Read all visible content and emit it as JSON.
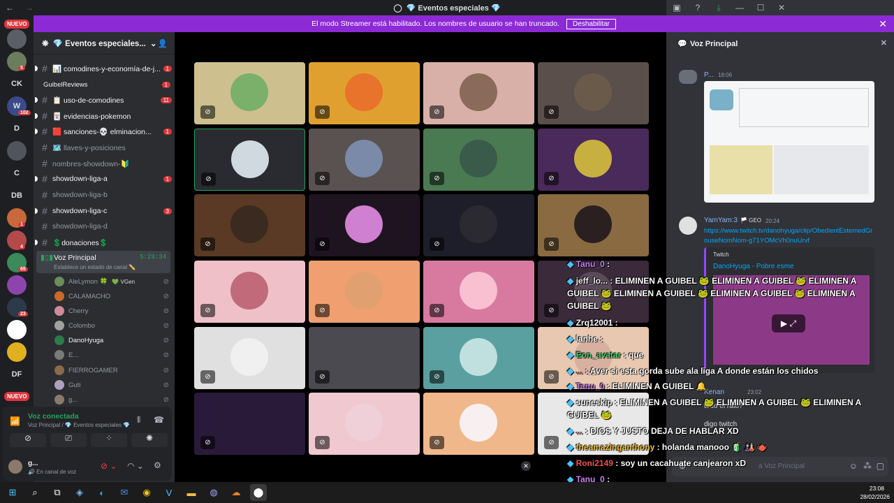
{
  "window": {
    "title": "💎 Eventos especiales 💎"
  },
  "banner": {
    "text": "El modo Streamer está habilitado. Los nombres de usuario se han truncado.",
    "button": "Deshabilitar"
  },
  "guilds": [
    {
      "label": "",
      "color": "#5a5f66"
    },
    {
      "label": "",
      "color": "#6b7d5c"
    },
    {
      "label": "CK",
      "color": "#1e1f22"
    },
    {
      "label": "W",
      "color": "#3b4a8a"
    },
    {
      "label": "D",
      "color": "#1e1f22"
    },
    {
      "label": "",
      "color": "#50545c"
    },
    {
      "label": "C",
      "color": "#1e1f22"
    },
    {
      "label": "DB",
      "color": "#1e1f22"
    },
    {
      "label": "",
      "color": "#c9683a"
    },
    {
      "label": "",
      "color": "#b34a4a"
    },
    {
      "label": "",
      "color": "#3a8a5a"
    },
    {
      "label": "",
      "color": "#8e44ad"
    },
    {
      "label": "",
      "color": "#2d3a4a"
    },
    {
      "label": "",
      "color": "#ffffff"
    },
    {
      "label": "",
      "color": "#e0b020"
    },
    {
      "label": "DF",
      "color": "#1e1f22"
    }
  ],
  "guild_badges": {
    "g2": "5",
    "g4": "102",
    "g9": "1",
    "g10": "4",
    "g11": "65",
    "g13": "23"
  },
  "nuevo": "NUEVO",
  "server": {
    "name": "💎 Eventos especiales..."
  },
  "channels": [
    {
      "name": "📊 comodines-y-economía-de-j...",
      "badge": "1",
      "unread": true
    },
    {
      "name": "GuibelReviews",
      "badge": "1",
      "unread": true,
      "thread": true
    },
    {
      "name": "📋 uso-de-comodines",
      "badge": "11",
      "unread": true
    },
    {
      "name": "🃏 evidencias-pokemon",
      "badge": "",
      "unread": true
    },
    {
      "name": "🟥 sanciones-💀 elminacion...",
      "badge": "1",
      "unread": true
    },
    {
      "name": "🗺️ llaves-y-posiciones",
      "badge": "",
      "unread": false
    },
    {
      "name": "nombres-showdown-🔰",
      "badge": "",
      "unread": false
    },
    {
      "name": "showdown-liga-a",
      "badge": "1",
      "unread": true
    },
    {
      "name": "showdown-liga-b",
      "badge": "",
      "unread": false
    },
    {
      "name": "showdown-liga-c",
      "badge": "3",
      "unread": true
    },
    {
      "name": "showdown-liga-d",
      "badge": "",
      "unread": false
    },
    {
      "name": "💲donaciones💲",
      "badge": "",
      "unread": true
    }
  ],
  "voice_channel": {
    "name": "Voz Principal",
    "timer": "5:29:34",
    "status": "Establece un estado de canal ✏️"
  },
  "voice_users": [
    {
      "name": "AleLymon 🍀",
      "tag": "💚 VGen",
      "color": "#6b8e5a"
    },
    {
      "name": "CALAMACHO",
      "tag": "",
      "color": "#c96a2a"
    },
    {
      "name": "Cherry",
      "tag": "",
      "color": "#d08a9a"
    },
    {
      "name": "Colombo",
      "tag": "",
      "color": "#a0a0a0"
    },
    {
      "name": "DanoHyuga",
      "tag": "",
      "color": "#2d7a4a"
    },
    {
      "name": "E...",
      "tag": "",
      "color": "#7a7a7a"
    },
    {
      "name": "FIERROGAMER",
      "tag": "",
      "color": "#8a6a4a"
    },
    {
      "name": "Guti",
      "tag": "",
      "color": "#b0a0c0"
    },
    {
      "name": "g...",
      "tag": "",
      "color": "#8a7a6a"
    }
  ],
  "connection": {
    "status": "Voz conectada",
    "location": "Voz Principal / 💎 Eventos especiales 💎"
  },
  "user": {
    "name": "g...",
    "status": "🔊 En canal de voz"
  },
  "tiles": [
    {
      "bg": "#cdc08e",
      "av": "#7ab06a"
    },
    {
      "bg": "#e0a030",
      "av": "#e8732a"
    },
    {
      "bg": "#d8b0a8",
      "av": "#8a6a5a"
    },
    {
      "bg": "#5a4f4a",
      "av": "#6a5a4a"
    },
    {
      "bg": "#2a2b30",
      "av": "#d0d8e0"
    },
    {
      "bg": "#5a5250",
      "av": "#7a8aa8"
    },
    {
      "bg": "#4a7a52",
      "av": "#3a5a4a"
    },
    {
      "bg": "#4a2a5a",
      "av": "#c8b040"
    },
    {
      "bg": "#5a3a24",
      "av": "#3a2a20"
    },
    {
      "bg": "#1e1420",
      "av": "#d080d0"
    },
    {
      "bg": "#1e1e2a",
      "av": "#2a2a30"
    },
    {
      "bg": "#8a6a40",
      "av": "#2a2020"
    },
    {
      "bg": "#f0c0c8",
      "av": "#c06a7a"
    },
    {
      "bg": "#f0a070",
      "av": "#e0a070"
    },
    {
      "bg": "#d87aa0",
      "av": "#f8c0d0"
    },
    {
      "bg": "#3a2a3a",
      "av": "#5a4a5a"
    },
    {
      "bg": "#e0e0e0",
      "av": "#f0f0f0"
    },
    {
      "bg": "#4a4a50",
      "av": "#4a4a50"
    },
    {
      "bg": "#5aa0a0",
      "av": "#c0e0e0"
    },
    {
      "bg": "#e8c8b0",
      "av": "#d8b0a0"
    },
    {
      "bg": "#2a1a3a",
      "av": "#2a1a3a"
    },
    {
      "bg": "#f0c8d0",
      "av": "#f0d0d8"
    },
    {
      "bg": "#f0b88a",
      "av": "#f8f0f0"
    },
    {
      "bg": "#e8e8e8",
      "av": "#e8e8e8"
    }
  ],
  "right_panel": {
    "title": "Voz Principal",
    "msg1": {
      "author": "P...",
      "time": "18:06"
    },
    "msg2": {
      "author": "YamYam:3",
      "tag": "🏳️ GEO",
      "time": "20:24",
      "link": "https://www.twitch.tv/danohyuga/clip/ObedientEstemedGrouseNomNom-g71YOMcVh0nuUrvf"
    },
    "embed": {
      "provider": "Twitch",
      "title": "DanoHyuga - Pobre esme"
    },
    "msg3": {
      "author": "Kenan",
      "time": "23:02",
      "text1": "todo el rato?",
      "text2": "digo twitch"
    },
    "input_placeholder": "a Voz Principal"
  },
  "chat_overlay": [
    {
      "u": "Tanu_0",
      "t": "",
      "uc": "#c880f0"
    },
    {
      "u": "jeff_lo...",
      "t": "ELIMINEN A GUIBEL 🐸 ELIMINEN A GUIBEL 🐸 ELIMINEN A",
      "uc": "#f0f0f0"
    },
    {
      "u": "",
      "t": "GUIBEL 🐸 ELIMINEN A GUIBEL 🐸 ELIMINEN A GUIBEL 🐸 ELIMINEN A",
      "uc": "#fff"
    },
    {
      "u": "",
      "t": "GUIBEL 🐸",
      "uc": "#fff"
    },
    {
      "u": "Zrq12001",
      "t": "",
      "uc": "#ffffff"
    },
    {
      "u": "lanhe",
      "t": "",
      "uc": "#ffffff"
    },
    {
      "u": "Eon_avatar",
      "t": "que",
      "uc": "#4ad070"
    },
    {
      "u": "...",
      "t": "Aver si esta gorda sube ala liga A donde están los chidos",
      "uc": "#f05050"
    },
    {
      "u": "Tanu_0",
      "t": "ELIMINEN A GUIBEL 🔔",
      "uc": "#c880f0"
    },
    {
      "u": "suneskip",
      "t": "ELIMINEN A GUIBEL 🐸 ELIMINEN A GUIBEL 🐸 ELIMINEN A",
      "uc": "#f0f0f0"
    },
    {
      "u": "",
      "t": "GUIBEL 🐸",
      "uc": "#fff"
    },
    {
      "u": "...",
      "t": "DIOS Y JUSTO DEJA DE HABLAR XD",
      "uc": "#f05050"
    },
    {
      "u": "theamazinganthony",
      "t": "holanda manooo 🧃 🎎 🫖",
      "uc": "#f0c040"
    },
    {
      "u": "Roni2149",
      "t": "soy un cacahuate canjearon xD",
      "uc": "#f05050"
    },
    {
      "u": "Tanu_0",
      "t": "",
      "uc": "#c880f0"
    },
    {
      "u": "Tanu_0",
      "t": "",
      "uc": "#c880f0"
    }
  ],
  "clock": {
    "time": "23:08",
    "date": "28/02/2026"
  }
}
